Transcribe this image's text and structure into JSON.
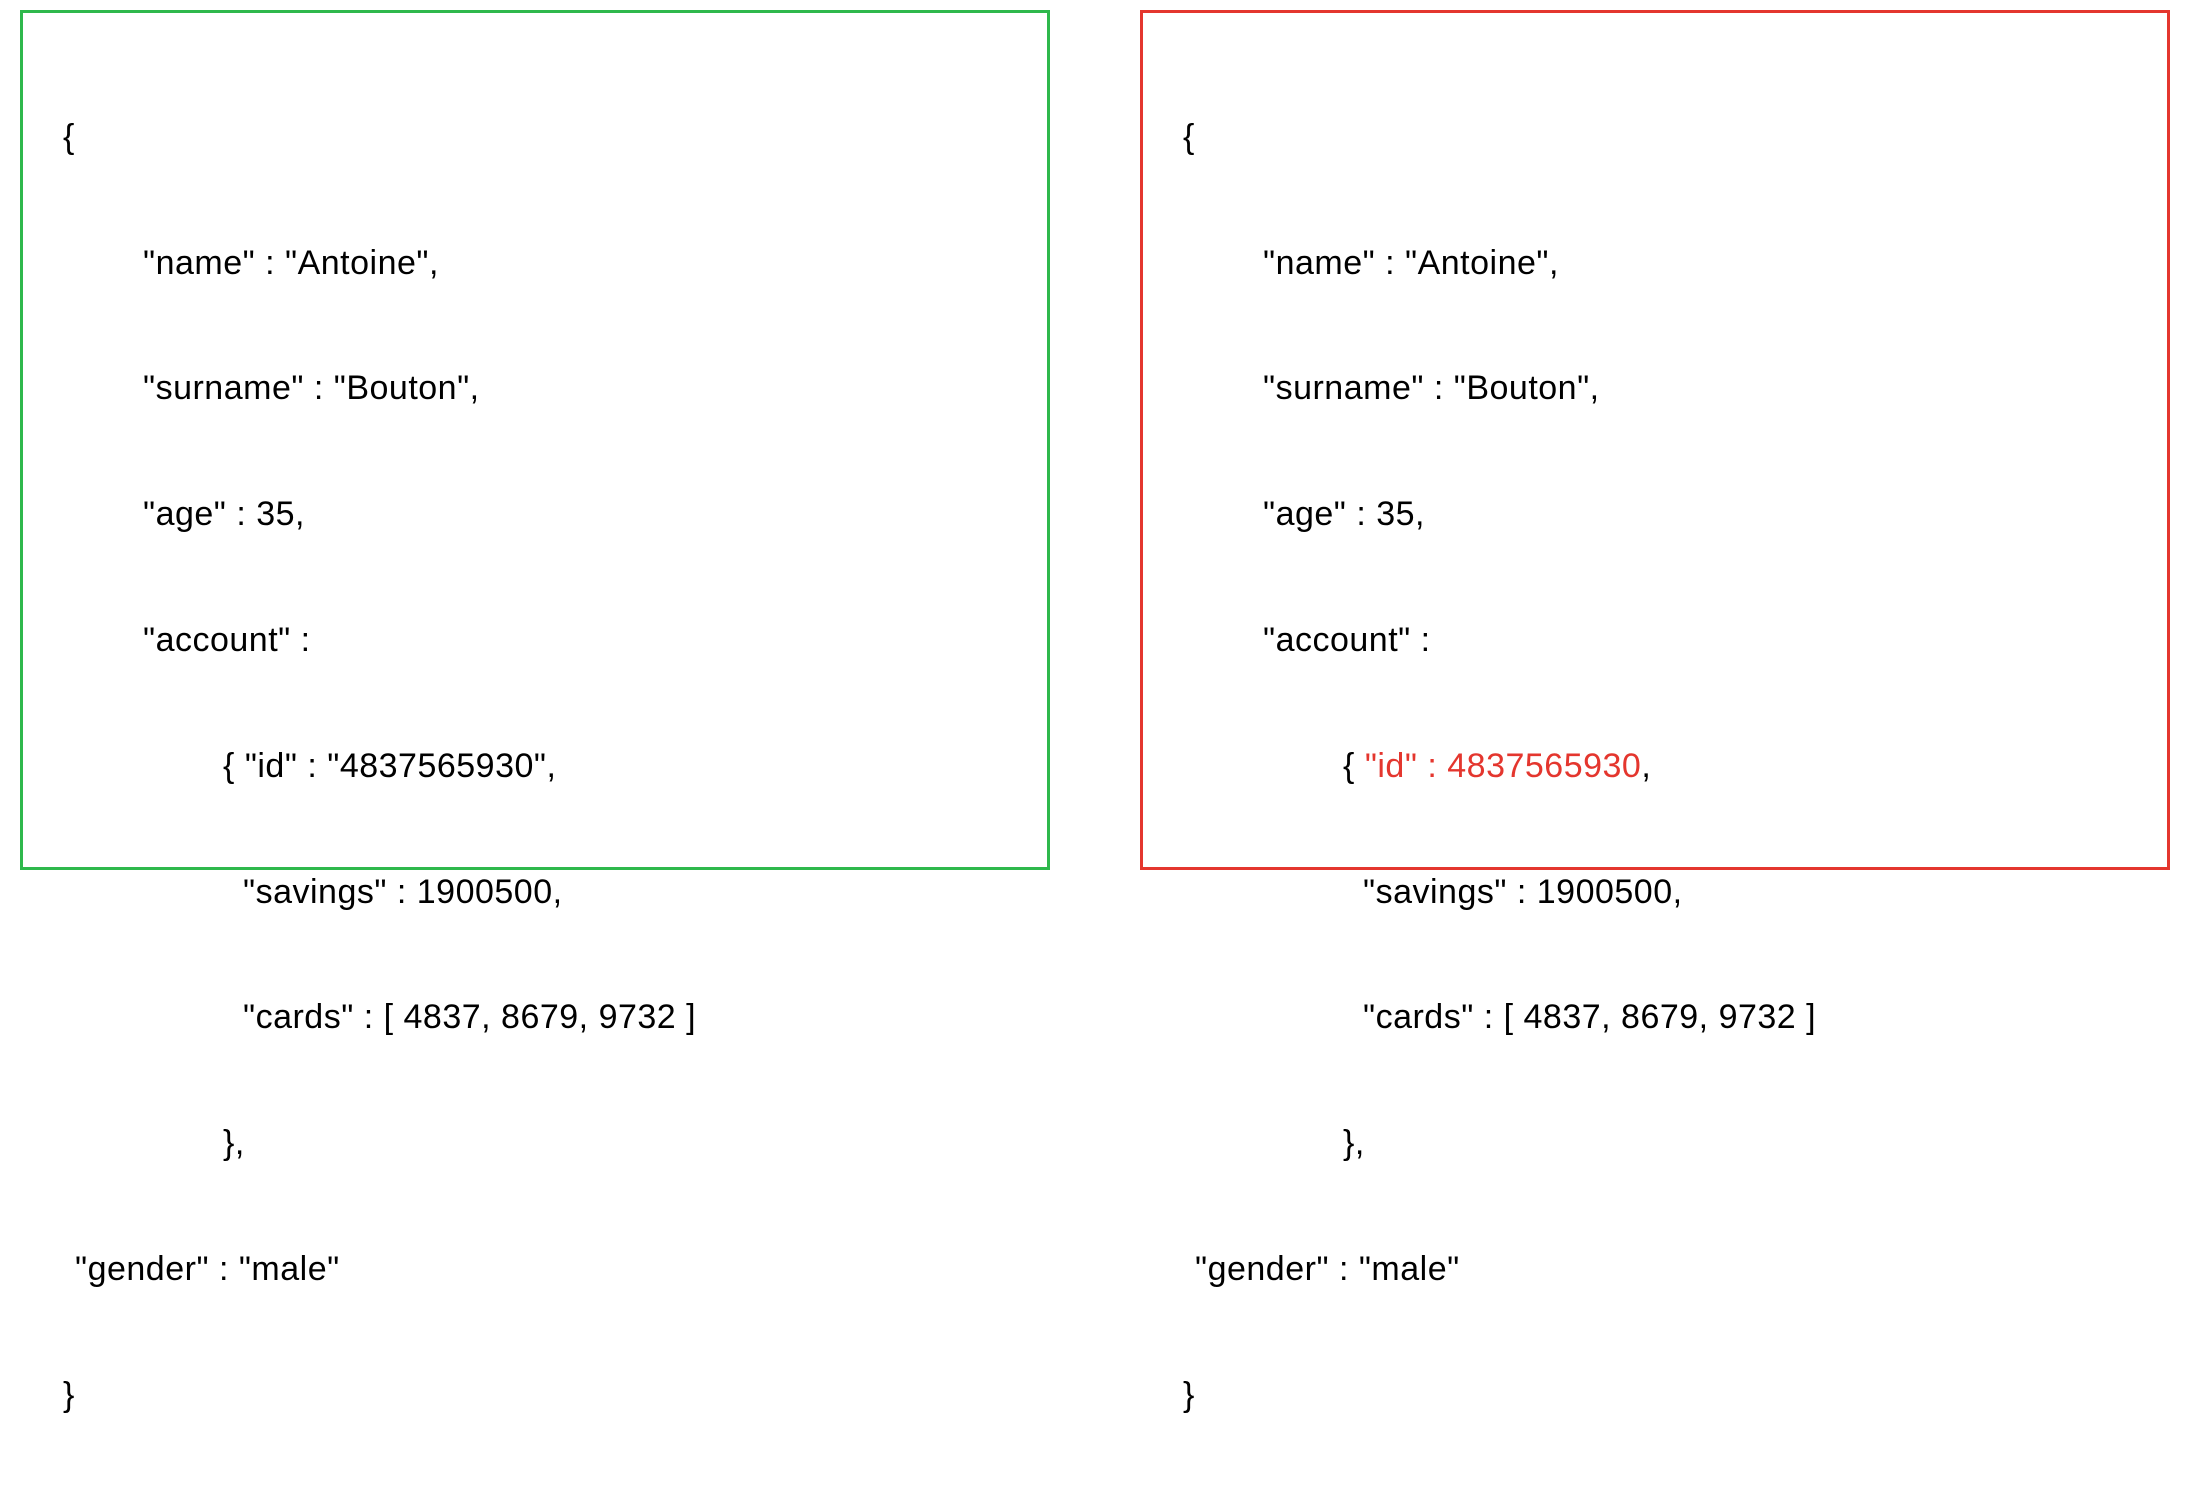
{
  "left": {
    "open_brace": "{",
    "name_line": "\"name\" : \"Antoine\",",
    "surname_line": "\"surname\" : \"Bouton\",",
    "age_line": "\"age\" : 35,",
    "account_line": "\"account\" :",
    "id_open": "{ ",
    "id_content": "\"id\" : \"4837565930\"",
    "id_close": ",",
    "savings_line": "\"savings\" : 1900500,",
    "cards_line": "\"cards\" : [ 4837, 8679, 9732 ]",
    "close_inner": "},",
    "gender_line": "\"gender\" : \"male\"",
    "close_brace": "}"
  },
  "right": {
    "open_brace": "{",
    "name_line": "\"name\" : \"Antoine\",",
    "surname_line": "\"surname\" : \"Bouton\",",
    "age_line": "\"age\" : 35,",
    "account_line": "\"account\" :",
    "id_open": "{ ",
    "id_content": "\"id\" : 4837565930",
    "id_close": ",",
    "savings_line": "\"savings\" : 1900500,",
    "cards_line": "\"cards\" : [ 4837, 8679, 9732 ]",
    "close_inner": "},",
    "gender_line": "\"gender\" : \"male\"",
    "close_brace": "}"
  },
  "colors": {
    "green": "#2fb84c",
    "red": "#e4362e"
  }
}
